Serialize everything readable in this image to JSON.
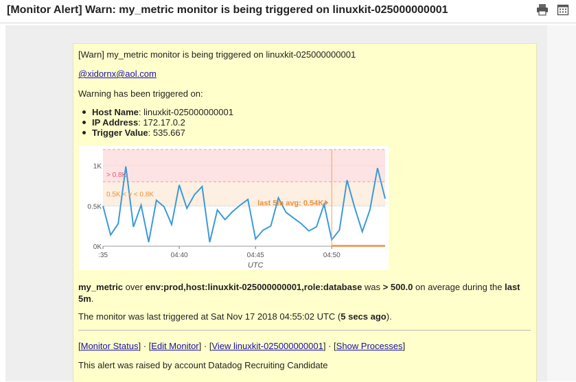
{
  "email": {
    "subject": "[Monitor Alert] Warn: my_metric monitor is being triggered on linuxkit-025000000001",
    "icons": [
      "print-icon",
      "calendar-icon"
    ]
  },
  "alert": {
    "title_line": "[Warn] my_metric monitor is being triggered on linuxkit-025000000001",
    "mention": "@xidornx@aol.com",
    "triggered_on": "Warning has been triggered on:",
    "details": [
      {
        "label": "Host Name",
        "value": ": linuxkit-025000000001"
      },
      {
        "label": "IP Address",
        "value": ": 172.17.0.2"
      },
      {
        "label": "Trigger Value",
        "value": ": 535.667"
      }
    ],
    "summary": {
      "metric": "my_metric",
      "over_text": " over ",
      "scope": "env:prod,host:linuxkit-025000000001,role:database",
      "was_text": " was ",
      "threshold": "> 500.0",
      "avg_text": " on average during the ",
      "period_line1": "last",
      "period_line2": "5m",
      "end": "."
    },
    "last_triggered_prefix": "The monitor was last triggered at Sat Nov 17 2018 04:55:02 UTC (",
    "last_triggered_ago": "5 secs ago",
    "last_triggered_suffix": ").",
    "links": [
      "Monitor Status",
      "Edit Monitor",
      "View linuxkit-025000000001",
      "Show Processes"
    ],
    "link_separator": " · ",
    "footer": "This alert was raised by account Datadog Recruiting Candidate"
  },
  "chart_data": {
    "type": "line",
    "x": [
      "04:35",
      "04:35:30",
      "04:36",
      "04:36:30",
      "04:37",
      "04:37:30",
      "04:38",
      "04:38:30",
      "04:39",
      "04:39:30",
      "04:40",
      "04:40:30",
      "04:41",
      "04:41:30",
      "04:42",
      "04:42:30",
      "04:43",
      "04:43:30",
      "04:44",
      "04:44:30",
      "04:45",
      "04:45:30",
      "04:46",
      "04:46:30",
      "04:47",
      "04:47:30",
      "04:48",
      "04:48:30",
      "04:49",
      "04:49:30",
      "04:50",
      "04:50:30",
      "04:51",
      "04:51:30",
      "04:52",
      "04:52:30",
      "04:53",
      "04:53:30",
      "04:54",
      "04:54:30",
      "04:55"
    ],
    "values": [
      0.5,
      0.14,
      0.28,
      0.99,
      0.24,
      0.51,
      0.05,
      0.57,
      0.49,
      0.27,
      0.76,
      0.47,
      0.64,
      0.74,
      0.05,
      0.45,
      0.33,
      0.43,
      0.51,
      0.58,
      0.09,
      0.2,
      0.25,
      0.6,
      0.42,
      0.35,
      0.28,
      0.19,
      0.24,
      0.52,
      0.08,
      0.2,
      0.82,
      0.48,
      0.18,
      0.45,
      0.97,
      0.59
    ],
    "xticks": [
      ":35",
      "04:40",
      "04:45",
      "04:50"
    ],
    "yticks": [
      "0K",
      "0.5K",
      "1K"
    ],
    "xlabel": "UTC",
    "ylim": [
      0,
      1.2
    ],
    "thresholds": {
      "alert_label": "> 0.8K",
      "warn_label": "0.5K < y < 0.8K",
      "alert_value": 0.8,
      "warn_value": 0.5
    },
    "annotation": "last 5m avg: 0.54K",
    "colors": {
      "line": "#3a9ad8",
      "alert_band": "#fde3e3",
      "warn_band": "#fdefe2",
      "alert_text": "#e0567a",
      "warn_text": "#e8923a",
      "marker": "#f0a060"
    }
  }
}
